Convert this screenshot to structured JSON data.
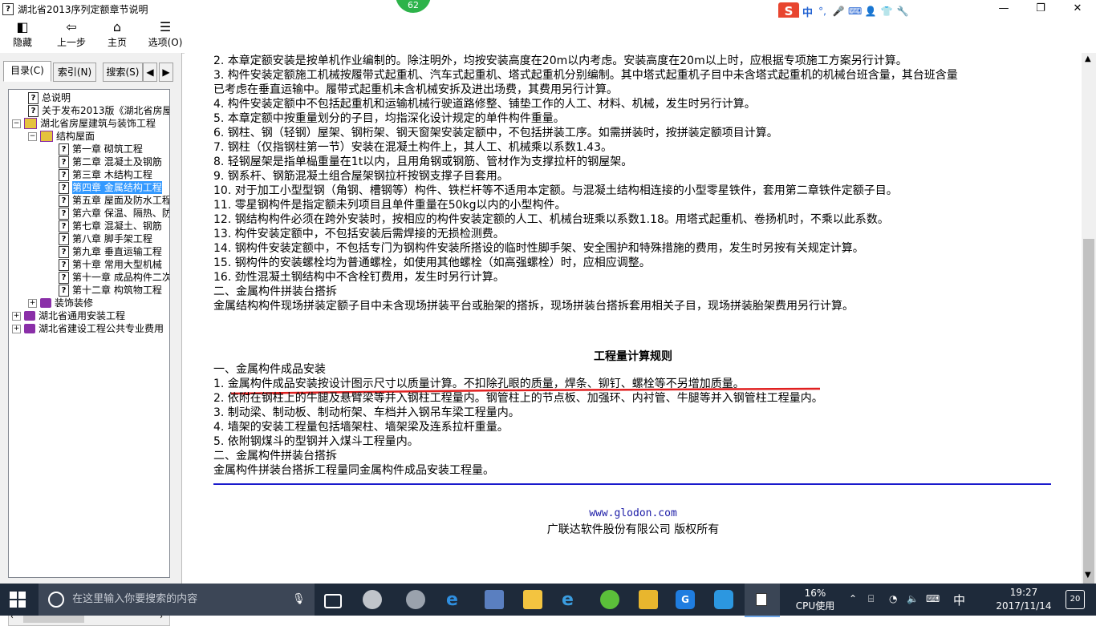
{
  "window": {
    "title": "湖北省2013序列定额章节说明",
    "badge": "62",
    "ime_label": "中"
  },
  "toolbar": {
    "hide": "隐藏",
    "back": "上一步",
    "home": "主页",
    "options": "选项(O)"
  },
  "left_tabs": {
    "contents": "目录(C)",
    "index": "索引(N)",
    "search": "搜索(S)"
  },
  "tree": [
    {
      "label": "总说明",
      "icon": "help-page-icon"
    },
    {
      "label": "关于发布2013版《湖北省房屋",
      "icon": "help-page-icon"
    },
    {
      "label": "湖北省房屋建筑与装饰工程",
      "icon": "open-book-icon"
    },
    {
      "label": "结构屋面",
      "icon": "open-book-icon"
    },
    {
      "label": "第一章  砌筑工程",
      "icon": "help-page-icon"
    },
    {
      "label": "第二章  混凝土及钢筋",
      "icon": "help-page-icon"
    },
    {
      "label": "第三章  木结构工程",
      "icon": "help-page-icon"
    },
    {
      "label": "第四章  金属结构工程",
      "icon": "help-page-icon"
    },
    {
      "label": "第五章  屋面及防水工程",
      "icon": "help-page-icon"
    },
    {
      "label": "第六章  保温、隔热、防",
      "icon": "help-page-icon"
    },
    {
      "label": "第七章  混凝土、钢筋",
      "icon": "help-page-icon"
    },
    {
      "label": "第八章  脚手架工程",
      "icon": "help-page-icon"
    },
    {
      "label": "第九章  垂直运输工程",
      "icon": "help-page-icon"
    },
    {
      "label": "第十章  常用大型机械",
      "icon": "help-page-icon"
    },
    {
      "label": "第十一章  成品构件二次",
      "icon": "help-page-icon"
    },
    {
      "label": "第十二章  构筑物工程",
      "icon": "help-page-icon"
    },
    {
      "label": "装饰装修",
      "icon": "closed-book-icon"
    },
    {
      "label": "湖北省通用安装工程",
      "icon": "closed-book-icon"
    },
    {
      "label": "湖北省建设工程公共专业费用",
      "icon": "closed-book-icon"
    }
  ],
  "content": {
    "lines1": [
      "2. 本章定额安装是按单机作业编制的。除注明外，均按安装高度在20m以内考虑。安装高度在20m以上时，应根据专项施工方案另行计算。",
      "3. 构件安装定额施工机械按履带式起重机、汽车式起重机、塔式起重机分别编制。其中塔式起重机子目中未含塔式起重机的机械台班含量，其台班含量",
      "已考虑在垂直运输中。履带式起重机未含机械安拆及进出场费，其费用另行计算。",
      "4. 构件安装定额中不包括起重机和运输机械行驶道路修整、铺垫工作的人工、材料、机械，发生时另行计算。",
      "5. 本章定额中按重量划分的子目，均指深化设计规定的单件构件重量。",
      "6. 钢柱、钢（轻钢）屋架、钢桁架、钢天窗架安装定额中，不包括拼装工序。如需拼装时，按拼装定额项目计算。",
      "7. 钢柱（仅指钢柱第一节）安装在混凝土构件上，其人工、机械乘以系数1.43。",
      "8. 轻钢屋架是指单榀重量在1t以内，且用角钢或钢筋、管材作为支撑拉杆的钢屋架。",
      "9. 钢系杆、钢筋混凝土组合屋架钢拉杆按钢支撑子目套用。",
      "10. 对于加工小型型钢（角钢、槽钢等）构件、铁栏杆等不适用本定额。与混凝土结构相连接的小型零星铁件，套用第二章铁件定额子目。",
      "11. 零星钢构件是指定额未列项目且单件重量在50kg以内的小型构件。",
      "12. 钢结构构件必须在跨外安装时，按相应的构件安装定额的人工、机械台班乘以系数1.18。用塔式起重机、卷扬机时，不乘以此系数。",
      "13. 构件安装定额中，不包括安装后需焊接的无损检测费。",
      "14. 钢构件安装定额中，不包括专门为钢构件安装所搭设的临时性脚手架、安全围护和特殊措施的费用，发生时另按有关规定计算。",
      "15. 钢构件的安装螺栓均为普通螺栓，如使用其他螺栓（如高强螺栓）时，应相应调整。",
      "16. 劲性混凝土钢结构中不含栓钉费用，发生时另行计算。"
    ],
    "section2_heading": "二、金属构件拼装台搭拆",
    "section2_text": "金属结构构件现场拼装定额子目中未含现场拼装平台或胎架的搭拆，现场拼装台搭拆套用相关子目，现场拼装胎架费用另行计算。",
    "rules_title": "工程量计算规则",
    "rules": [
      "一、金属构件成品安装",
      "1. 金属构件成品安装按设计图示尺寸以质量计算。不扣除孔眼的质量，焊条、铆钉、螺栓等不另增加质量。",
      "2. 依附在钢柱上的牛腿及悬臂梁等并入钢柱工程量内。钢管柱上的节点板、加强环、内衬管、牛腿等并入钢管柱工程量内。",
      "3. 制动梁、制动板、制动桁架、车档并入钢吊车梁工程量内。",
      "4. 墙架的安装工程量包括墙架柱、墙架梁及连系拉杆重量。",
      "5. 依附钢煤斗的型钢并入煤斗工程量内。",
      "二、金属构件拼装台搭拆",
      "金属构件拼装台搭拆工程量同金属构件成品安装工程量。"
    ],
    "footer_link": "www.glodon.com",
    "footer_copyright": "广联达软件股份有限公司 版权所有"
  },
  "taskbar": {
    "search_placeholder": "在这里输入你要搜索的内容",
    "cpu_percent": "16%",
    "cpu_label": "CPU使用",
    "ime": "中",
    "time": "19:27",
    "date": "2017/11/14",
    "notif_count": "20"
  }
}
